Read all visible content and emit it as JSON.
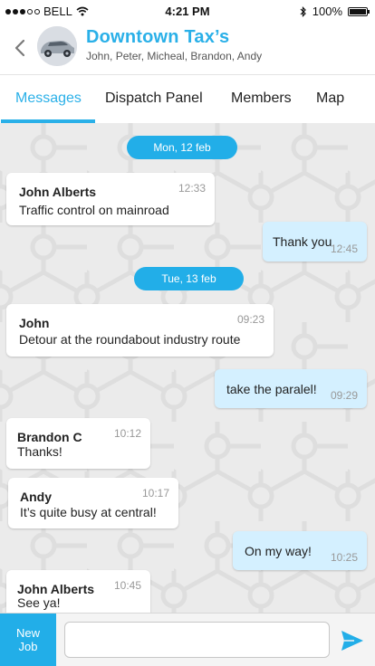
{
  "statusbar": {
    "carrier": "BELL",
    "time": "4:21 PM",
    "battery": "100%"
  },
  "header": {
    "title": "Downtown Tax’s",
    "members": "John, Peter, Micheal, Brandon, Andy"
  },
  "tabs": [
    {
      "label": "Messages",
      "active": true
    },
    {
      "label": "Dispatch Panel",
      "active": false
    },
    {
      "label": "Members",
      "active": false
    },
    {
      "label": "Map",
      "active": false
    }
  ],
  "chat": {
    "dates": [
      "Mon, 12 feb",
      "Tue, 13 feb"
    ],
    "messages": [
      {
        "direction": "in",
        "sender": "John Alberts",
        "text": "Traffic control on mainroad",
        "time": "12:33"
      },
      {
        "direction": "out",
        "text": "Thank you",
        "time": "12:45"
      },
      {
        "direction": "in",
        "sender": "John",
        "text": "Detour at the roundabout industry route",
        "time": "09:23"
      },
      {
        "direction": "out",
        "text": "take the paralel!",
        "time": "09:29"
      },
      {
        "direction": "in",
        "sender": "Brandon C",
        "text": "Thanks!",
        "time": "10:12"
      },
      {
        "direction": "in",
        "sender": "Andy",
        "text": "It’s quite busy at central!",
        "time": "10:17"
      },
      {
        "direction": "out",
        "text": "On my way!",
        "time": "10:25"
      },
      {
        "direction": "in",
        "sender": "John Alberts",
        "text": "See ya!",
        "time": "10:45"
      }
    ]
  },
  "composer": {
    "new_job_line1": "New",
    "new_job_line2": "Job",
    "input_value": "",
    "input_placeholder": ""
  },
  "colors": {
    "accent": "#22aee8",
    "outgoing_bubble": "#d4f0ff",
    "incoming_bubble": "#ffffff"
  },
  "icons": [
    "back-chevron-icon",
    "signal-dots-icon",
    "wifi-icon",
    "bluetooth-icon",
    "battery-icon",
    "send-icon"
  ]
}
